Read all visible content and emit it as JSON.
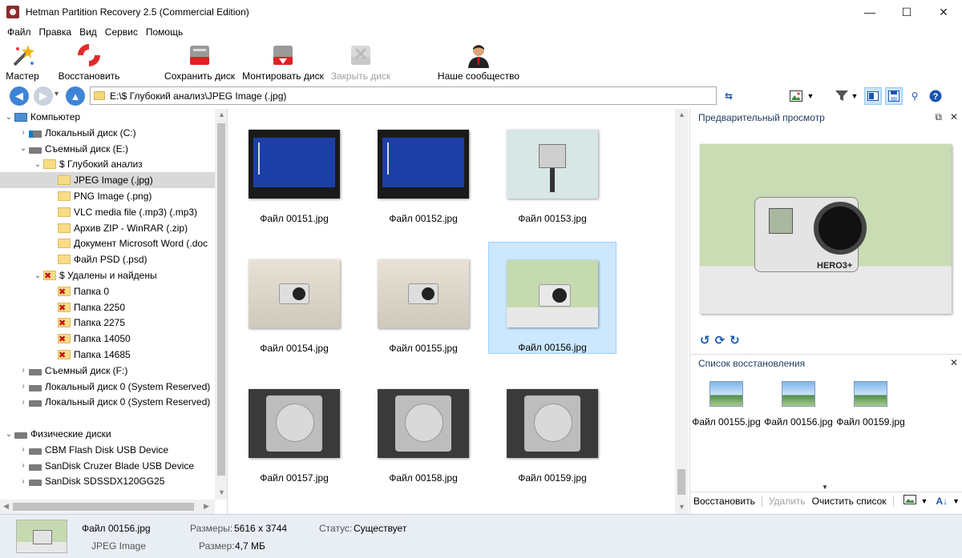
{
  "window": {
    "title": "Hetman Partition Recovery 2.5 (Commercial Edition)",
    "controls": {
      "minimize": "—",
      "maximize": "☐",
      "close": "✕"
    }
  },
  "menu": [
    "Файл",
    "Правка",
    "Вид",
    "Сервис",
    "Помощь"
  ],
  "toolbar": {
    "wizard": "Мастер",
    "restore": "Восстановить",
    "save_disk": "Сохранить диск",
    "mount_disk": "Монтировать диск",
    "close_disk": "Закрыть диск",
    "community": "Наше сообщество"
  },
  "nav": {
    "back": "◀",
    "forward": "▶",
    "up": "▲",
    "dropdown": "▾",
    "path": "E:\\$ Глубокий анализ\\JPEG Image (.jpg)"
  },
  "tree": [
    {
      "label": "Компьютер",
      "level": 0,
      "icon": "computer-icon",
      "expander": "⌄"
    },
    {
      "label": "Локальный диск (C:)",
      "level": 1,
      "icon": "drive-windows-icon",
      "expander": "›"
    },
    {
      "label": "Съемный диск (E:)",
      "level": 1,
      "icon": "drive-icon",
      "expander": "⌄"
    },
    {
      "label": "$ Глубокий анализ",
      "level": 2,
      "icon": "folder-icon",
      "expander": "⌄"
    },
    {
      "label": "JPEG Image (.jpg)",
      "level": 3,
      "icon": "folder-icon",
      "expander": "",
      "selected": true
    },
    {
      "label": "PNG Image (.png)",
      "level": 3,
      "icon": "folder-icon",
      "expander": ""
    },
    {
      "label": "VLC media file (.mp3) (.mp3)",
      "level": 3,
      "icon": "folder-icon",
      "expander": ""
    },
    {
      "label": "Архив ZIP - WinRAR (.zip)",
      "level": 3,
      "icon": "folder-icon",
      "expander": ""
    },
    {
      "label": "Документ Microsoft Word (.doc",
      "level": 3,
      "icon": "folder-icon",
      "expander": ""
    },
    {
      "label": "Файл PSD (.psd)",
      "level": 3,
      "icon": "folder-icon",
      "expander": ""
    },
    {
      "label": "$ Удалены и найдены",
      "level": 2,
      "icon": "deleted-folder-icon",
      "expander": "⌄"
    },
    {
      "label": "Папка 0",
      "level": 3,
      "icon": "deleted-folder-icon",
      "expander": ""
    },
    {
      "label": "Папка 2250",
      "level": 3,
      "icon": "deleted-folder-icon",
      "expander": ""
    },
    {
      "label": "Папка 2275",
      "level": 3,
      "icon": "deleted-folder-icon",
      "expander": ""
    },
    {
      "label": "Папка 14050",
      "level": 3,
      "icon": "deleted-folder-icon",
      "expander": ""
    },
    {
      "label": "Папка 14685",
      "level": 3,
      "icon": "deleted-folder-icon",
      "expander": ""
    },
    {
      "label": "Съемный диск (F:)",
      "level": 1,
      "icon": "drive-icon",
      "expander": "›"
    },
    {
      "label": "Локальный диск 0 (System Reserved)",
      "level": 1,
      "icon": "drive-icon",
      "expander": "›"
    },
    {
      "label": "Локальный диск 0 (System Reserved)",
      "level": 1,
      "icon": "drive-icon",
      "expander": "›"
    },
    {
      "label": "",
      "level": 0,
      "icon": "",
      "expander": ""
    },
    {
      "label": "Физические диски",
      "level": 0,
      "icon": "drive-icon",
      "expander": "⌄"
    },
    {
      "label": "CBM Flash Disk USB Device",
      "level": 1,
      "icon": "drive-icon",
      "expander": "›"
    },
    {
      "label": "SanDisk Cruzer Blade USB Device",
      "level": 1,
      "icon": "drive-icon",
      "expander": "›"
    },
    {
      "label": "SanDisk SDSSDX120GG25",
      "level": 1,
      "icon": "drive-icon",
      "expander": "›"
    }
  ],
  "files": [
    {
      "name": "Файл 00151.jpg",
      "kind": "screen"
    },
    {
      "name": "Файл 00152.jpg",
      "kind": "screen"
    },
    {
      "name": "Файл 00153.jpg",
      "kind": "mount"
    },
    {
      "name": "Файл 00154.jpg",
      "kind": "camera"
    },
    {
      "name": "Файл 00155.jpg",
      "kind": "camera"
    },
    {
      "name": "Файл 00156.jpg",
      "kind": "green",
      "selected": true
    },
    {
      "name": "Файл 00157.jpg",
      "kind": "hdd"
    },
    {
      "name": "Файл 00158.jpg",
      "kind": "hdd"
    },
    {
      "name": "Файл 00159.jpg",
      "kind": "hdd"
    }
  ],
  "preview": {
    "title": "Предварительный просмотр",
    "brand_text": "HERO3+",
    "rotate_icons": [
      "↺",
      "⟳",
      "↻"
    ]
  },
  "recovery_list": {
    "title": "Список восстановления",
    "items": [
      "Файл 00155.jpg",
      "Файл 00156.jpg",
      "Файл 00159.jpg"
    ],
    "restore": "Восстановить",
    "delete": "Удалить",
    "clear": "Очистить список"
  },
  "status": {
    "file_name": "Файл 00156.jpg",
    "file_type": "JPEG Image",
    "dimensions_label": "Размеры:",
    "dimensions_value": "5616 x 3744",
    "size_label": "Размер:",
    "size_value": "4,7 МБ",
    "state_label": "Статус:",
    "state_value": "Существует"
  },
  "colors": {
    "accent": "#1a56b0",
    "selection": "#cce8ff",
    "statusbar": "#e9eef5",
    "delete_mark": "#d01010"
  }
}
